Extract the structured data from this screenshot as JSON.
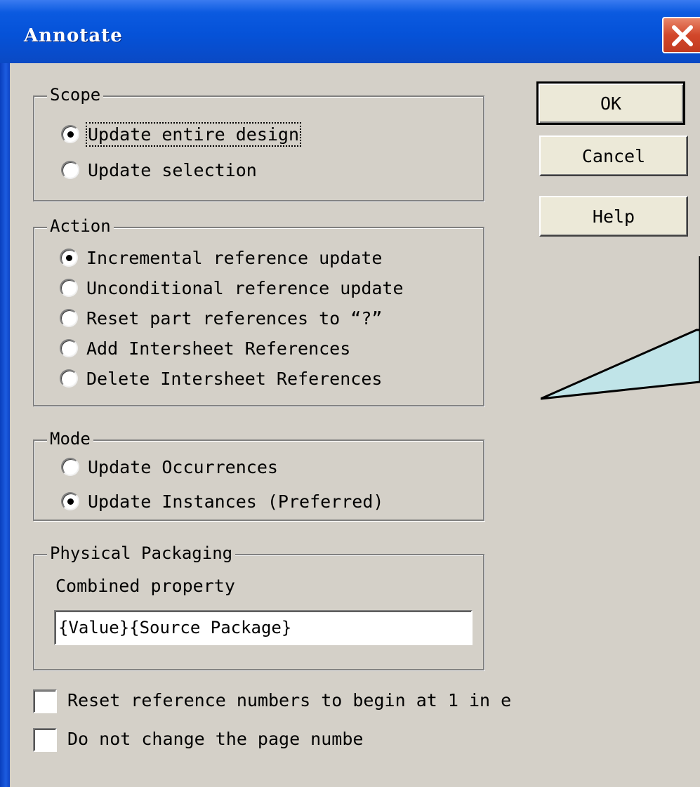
{
  "window": {
    "title": "Annotate"
  },
  "scope": {
    "legend": "Scope",
    "options": [
      {
        "label": "Update entire design",
        "checked": true
      },
      {
        "label": "Update selection",
        "checked": false
      }
    ]
  },
  "action": {
    "legend": "Action",
    "options": [
      {
        "label": "Incremental reference update",
        "checked": true
      },
      {
        "label": "Unconditional reference update",
        "checked": false
      },
      {
        "label": "Reset part references to “?”",
        "checked": false
      },
      {
        "label": "Add Intersheet References",
        "checked": false
      },
      {
        "label": "Delete Intersheet References",
        "checked": false
      }
    ]
  },
  "mode": {
    "legend": "Mode",
    "options": [
      {
        "label": "Update Occurrences",
        "checked": false
      },
      {
        "label": "Update Instances (Preferred)",
        "checked": true
      }
    ]
  },
  "packaging": {
    "legend": "Physical Packaging",
    "field_label": "Combined property",
    "field_value": "{Value}{Source Package}"
  },
  "buttons": {
    "ok": "OK",
    "cancel": "Cancel",
    "help": "Help"
  },
  "checkboxes": [
    {
      "label": "Reset reference numbers to begin at 1 in e",
      "checked": false
    },
    {
      "label": "Do not change the page numbe",
      "checked": false
    }
  ],
  "colors": {
    "dialog_bg": "#d4d0c8",
    "titlebar": "#0552d8",
    "callout_fill": "#c0e4e8"
  },
  "icons": {
    "close": "close-icon"
  }
}
